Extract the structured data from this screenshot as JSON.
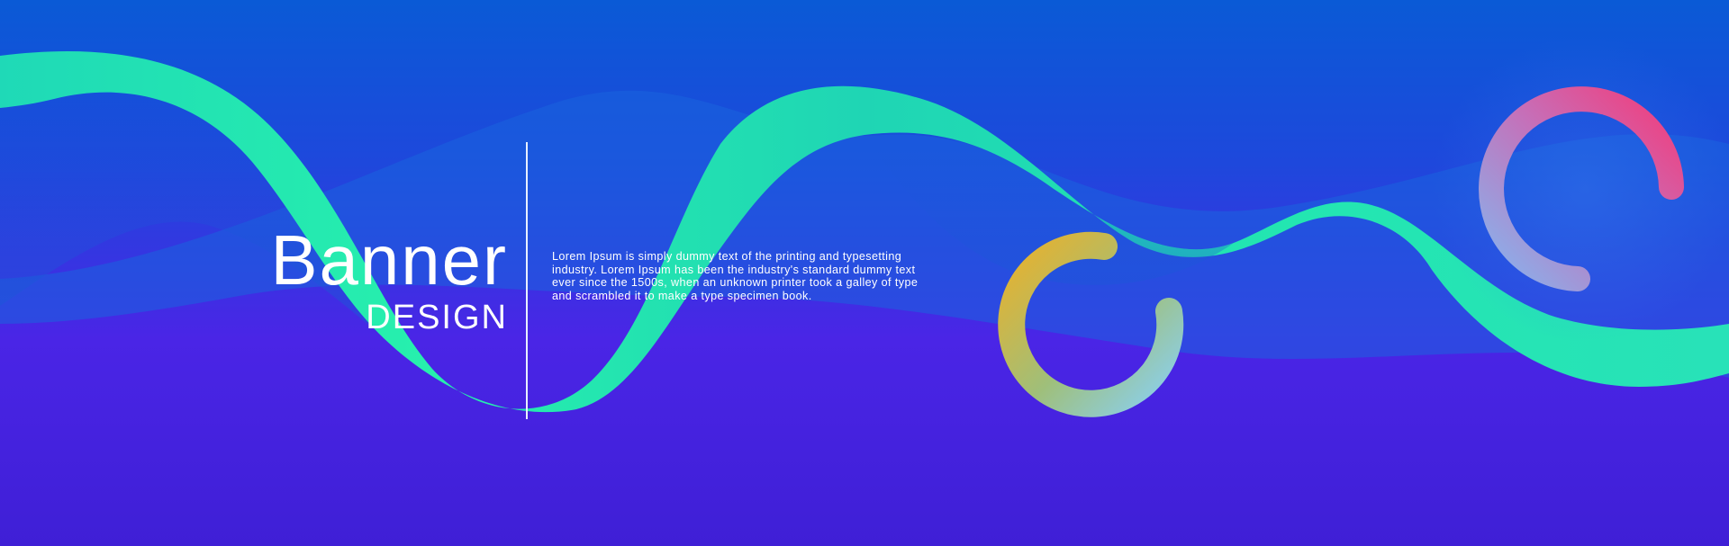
{
  "banner": {
    "title": "Banner",
    "subtitle": "DESIGN",
    "body": "Lorem Ipsum is simply dummy text of the printing and typesetting industry. Lorem Ipsum has been the industry's standard dummy text ever since the 1500s, when an unknown printer took a galley of type  and scrambled it to make a type specimen book."
  },
  "colors": {
    "background_top": "#0a5ad6",
    "background_bottom": "#4a25e6",
    "wave_teal": "#22ecb0",
    "ring_yellow": "#e7b53a",
    "ring_pink": "#ef3e7f",
    "ring_light_blue": "#8fd2f0"
  }
}
